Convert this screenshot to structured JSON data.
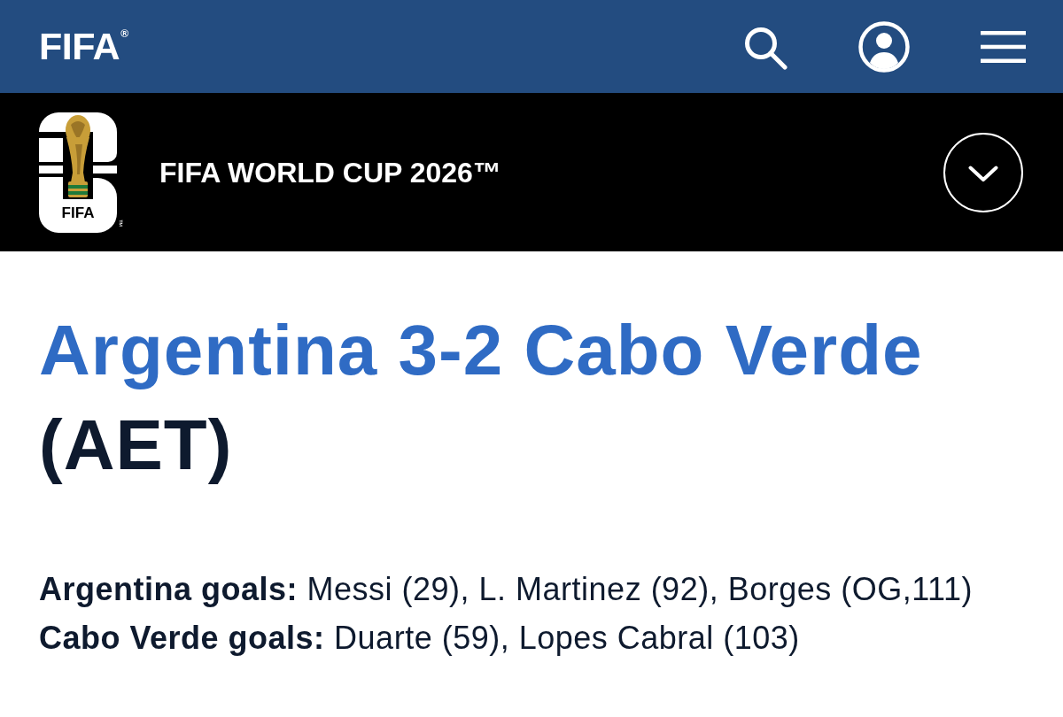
{
  "top_bar": {
    "logo": "FIFA$^{®}$",
    "actions": [
      {
        "kind": "search"
      },
      {
        "kind": "account"
      },
      {
        "kind": "menu"
      }
    ]
  },
  "tournament_bar": {
    "emblem": {
      "wordmark": "FIFA",
      "trademark": "™"
    },
    "title": "FIFA WORLD CUP 2026™",
    "expanded": false
  },
  "headline": {
    "score_line": "Argentina 3-2 Cabo Verde",
    "note": "(AET)"
  },
  "goals": [
    "**Argentina goals:** Messi (29), L. Martinez (92), Borges (OG,111)",
    "**Cabo Verde goals:** Duarte (59), Lopes Cabral (103)"
  ]
}
